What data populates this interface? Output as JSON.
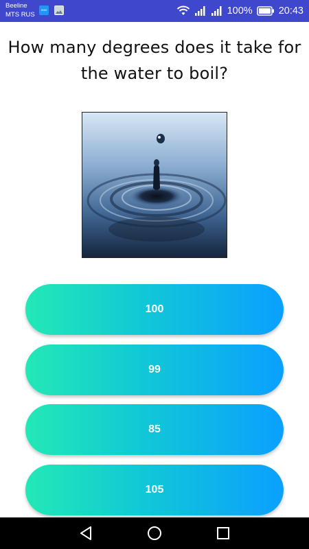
{
  "status_bar": {
    "carrier_line1": "Beeline",
    "carrier_line2": "MTS RUS",
    "notif_app_label": "ЛМН",
    "battery_percent": "100%",
    "time": "20:43",
    "icons": [
      "app-notification-icon",
      "image-notification-icon",
      "wifi-icon",
      "signal-icon",
      "signal-icon",
      "battery-icon"
    ],
    "color": "#3f48cc"
  },
  "question": {
    "text": "How many degrees does it take for the water to boil?"
  },
  "image": {
    "subject": "water-drop-ripple"
  },
  "answers": [
    {
      "label": "100"
    },
    {
      "label": "99"
    },
    {
      "label": "85"
    },
    {
      "label": "105"
    }
  ],
  "colors": {
    "gradient_start": "#23e8b5",
    "gradient_end": "#0aa0ff"
  },
  "nav_bar": {
    "icons": [
      "back-icon",
      "home-icon",
      "recent-apps-icon"
    ]
  }
}
